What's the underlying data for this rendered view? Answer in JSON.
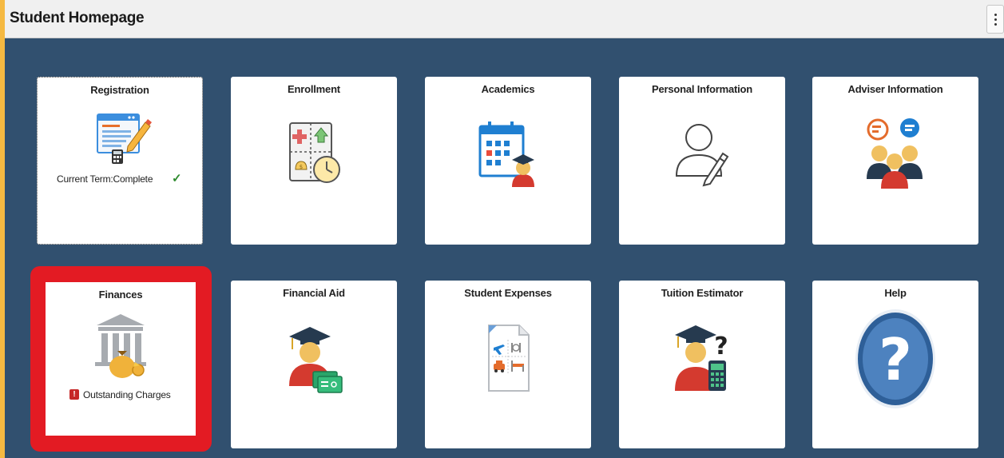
{
  "header": {
    "title": "Student Homepage"
  },
  "tiles": [
    {
      "title": "Registration",
      "status": "Current Term:Complete",
      "status_icon": "check-icon"
    },
    {
      "title": "Enrollment"
    },
    {
      "title": "Academics"
    },
    {
      "title": "Personal Information"
    },
    {
      "title": "Adviser Information"
    },
    {
      "title": "Finances",
      "status": "Outstanding Charges",
      "status_icon": "alert-icon"
    },
    {
      "title": "Financial Aid"
    },
    {
      "title": "Student Expenses"
    },
    {
      "title": "Tuition Estimator"
    },
    {
      "title": "Help"
    }
  ],
  "colors": {
    "background": "#31506f",
    "outer_border": "#f5b942",
    "highlight": "#e31b23",
    "check": "#2e8b2e",
    "alert": "#c62828"
  }
}
